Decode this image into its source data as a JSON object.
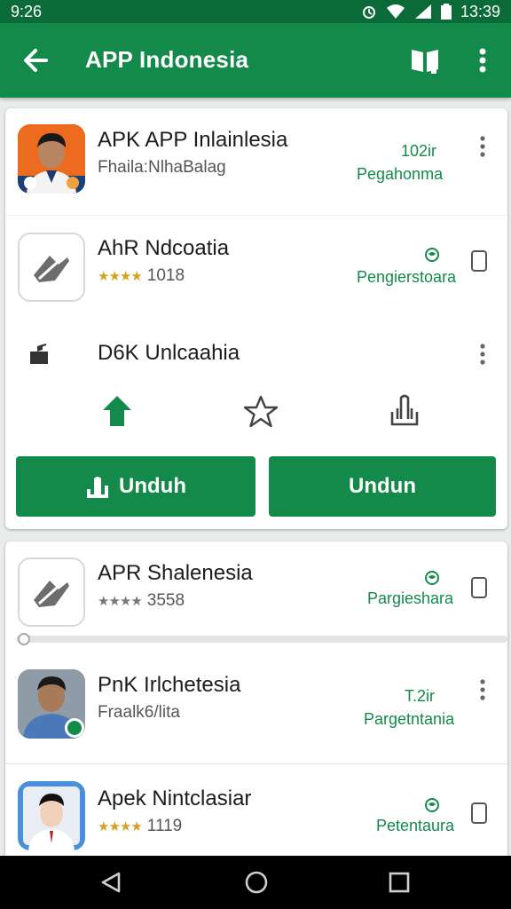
{
  "status": {
    "left_time": "9:26",
    "right_time": "13:39"
  },
  "app_bar": {
    "title": "APP Indonesia"
  },
  "items": [
    {
      "name": "APK APP Inlainlesia",
      "subtitle": "Fhaila:NlhaBalag",
      "top_right": "102ir",
      "right_label": "Pegahonma"
    },
    {
      "name": "AhR Ndcoatia",
      "stars": "★★★★",
      "rating": "1018",
      "right_label": "Pengierstoara"
    },
    {
      "name": "D6K Unlcaahia"
    },
    {
      "name": "APR Shalenesia",
      "stars": "★★★★",
      "rating": "3558",
      "right_label": "Pargieshara"
    },
    {
      "name": "PnK Irlchetesia",
      "subtitle": "Fraalk6/lita",
      "top_right": "T.2ir",
      "right_label": "Pargetntania"
    },
    {
      "name": "Apek Nintclasiar",
      "stars": "★★★★",
      "rating": "1119",
      "right_label": "Petentaura"
    }
  ],
  "buttons": {
    "download_left": "Unduh",
    "download_right": "Undun"
  },
  "icons": {
    "back": "arrow-left-icon",
    "book": "book-icon",
    "more": "more-vert-icon",
    "upload": "upload-arrow-icon",
    "star": "star-outline-icon",
    "share": "hand-icon"
  },
  "colors": {
    "primary": "#138a4a",
    "status_bar": "#0a6b39",
    "star": "#d6a021"
  }
}
